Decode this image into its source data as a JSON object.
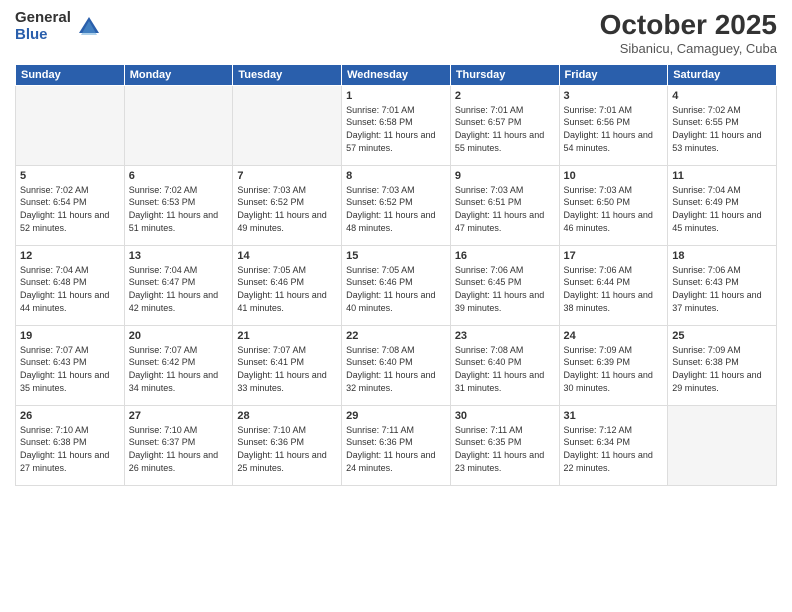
{
  "logo": {
    "general": "General",
    "blue": "Blue"
  },
  "header": {
    "month": "October 2025",
    "location": "Sibanicu, Camaguey, Cuba"
  },
  "weekdays": [
    "Sunday",
    "Monday",
    "Tuesday",
    "Wednesday",
    "Thursday",
    "Friday",
    "Saturday"
  ],
  "weeks": [
    [
      {
        "num": "",
        "info": ""
      },
      {
        "num": "",
        "info": ""
      },
      {
        "num": "",
        "info": ""
      },
      {
        "num": "1",
        "info": "Sunrise: 7:01 AM\nSunset: 6:58 PM\nDaylight: 11 hours and 57 minutes."
      },
      {
        "num": "2",
        "info": "Sunrise: 7:01 AM\nSunset: 6:57 PM\nDaylight: 11 hours and 55 minutes."
      },
      {
        "num": "3",
        "info": "Sunrise: 7:01 AM\nSunset: 6:56 PM\nDaylight: 11 hours and 54 minutes."
      },
      {
        "num": "4",
        "info": "Sunrise: 7:02 AM\nSunset: 6:55 PM\nDaylight: 11 hours and 53 minutes."
      }
    ],
    [
      {
        "num": "5",
        "info": "Sunrise: 7:02 AM\nSunset: 6:54 PM\nDaylight: 11 hours and 52 minutes."
      },
      {
        "num": "6",
        "info": "Sunrise: 7:02 AM\nSunset: 6:53 PM\nDaylight: 11 hours and 51 minutes."
      },
      {
        "num": "7",
        "info": "Sunrise: 7:03 AM\nSunset: 6:52 PM\nDaylight: 11 hours and 49 minutes."
      },
      {
        "num": "8",
        "info": "Sunrise: 7:03 AM\nSunset: 6:52 PM\nDaylight: 11 hours and 48 minutes."
      },
      {
        "num": "9",
        "info": "Sunrise: 7:03 AM\nSunset: 6:51 PM\nDaylight: 11 hours and 47 minutes."
      },
      {
        "num": "10",
        "info": "Sunrise: 7:03 AM\nSunset: 6:50 PM\nDaylight: 11 hours and 46 minutes."
      },
      {
        "num": "11",
        "info": "Sunrise: 7:04 AM\nSunset: 6:49 PM\nDaylight: 11 hours and 45 minutes."
      }
    ],
    [
      {
        "num": "12",
        "info": "Sunrise: 7:04 AM\nSunset: 6:48 PM\nDaylight: 11 hours and 44 minutes."
      },
      {
        "num": "13",
        "info": "Sunrise: 7:04 AM\nSunset: 6:47 PM\nDaylight: 11 hours and 42 minutes."
      },
      {
        "num": "14",
        "info": "Sunrise: 7:05 AM\nSunset: 6:46 PM\nDaylight: 11 hours and 41 minutes."
      },
      {
        "num": "15",
        "info": "Sunrise: 7:05 AM\nSunset: 6:46 PM\nDaylight: 11 hours and 40 minutes."
      },
      {
        "num": "16",
        "info": "Sunrise: 7:06 AM\nSunset: 6:45 PM\nDaylight: 11 hours and 39 minutes."
      },
      {
        "num": "17",
        "info": "Sunrise: 7:06 AM\nSunset: 6:44 PM\nDaylight: 11 hours and 38 minutes."
      },
      {
        "num": "18",
        "info": "Sunrise: 7:06 AM\nSunset: 6:43 PM\nDaylight: 11 hours and 37 minutes."
      }
    ],
    [
      {
        "num": "19",
        "info": "Sunrise: 7:07 AM\nSunset: 6:43 PM\nDaylight: 11 hours and 35 minutes."
      },
      {
        "num": "20",
        "info": "Sunrise: 7:07 AM\nSunset: 6:42 PM\nDaylight: 11 hours and 34 minutes."
      },
      {
        "num": "21",
        "info": "Sunrise: 7:07 AM\nSunset: 6:41 PM\nDaylight: 11 hours and 33 minutes."
      },
      {
        "num": "22",
        "info": "Sunrise: 7:08 AM\nSunset: 6:40 PM\nDaylight: 11 hours and 32 minutes."
      },
      {
        "num": "23",
        "info": "Sunrise: 7:08 AM\nSunset: 6:40 PM\nDaylight: 11 hours and 31 minutes."
      },
      {
        "num": "24",
        "info": "Sunrise: 7:09 AM\nSunset: 6:39 PM\nDaylight: 11 hours and 30 minutes."
      },
      {
        "num": "25",
        "info": "Sunrise: 7:09 AM\nSunset: 6:38 PM\nDaylight: 11 hours and 29 minutes."
      }
    ],
    [
      {
        "num": "26",
        "info": "Sunrise: 7:10 AM\nSunset: 6:38 PM\nDaylight: 11 hours and 27 minutes."
      },
      {
        "num": "27",
        "info": "Sunrise: 7:10 AM\nSunset: 6:37 PM\nDaylight: 11 hours and 26 minutes."
      },
      {
        "num": "28",
        "info": "Sunrise: 7:10 AM\nSunset: 6:36 PM\nDaylight: 11 hours and 25 minutes."
      },
      {
        "num": "29",
        "info": "Sunrise: 7:11 AM\nSunset: 6:36 PM\nDaylight: 11 hours and 24 minutes."
      },
      {
        "num": "30",
        "info": "Sunrise: 7:11 AM\nSunset: 6:35 PM\nDaylight: 11 hours and 23 minutes."
      },
      {
        "num": "31",
        "info": "Sunrise: 7:12 AM\nSunset: 6:34 PM\nDaylight: 11 hours and 22 minutes."
      },
      {
        "num": "",
        "info": ""
      }
    ]
  ]
}
